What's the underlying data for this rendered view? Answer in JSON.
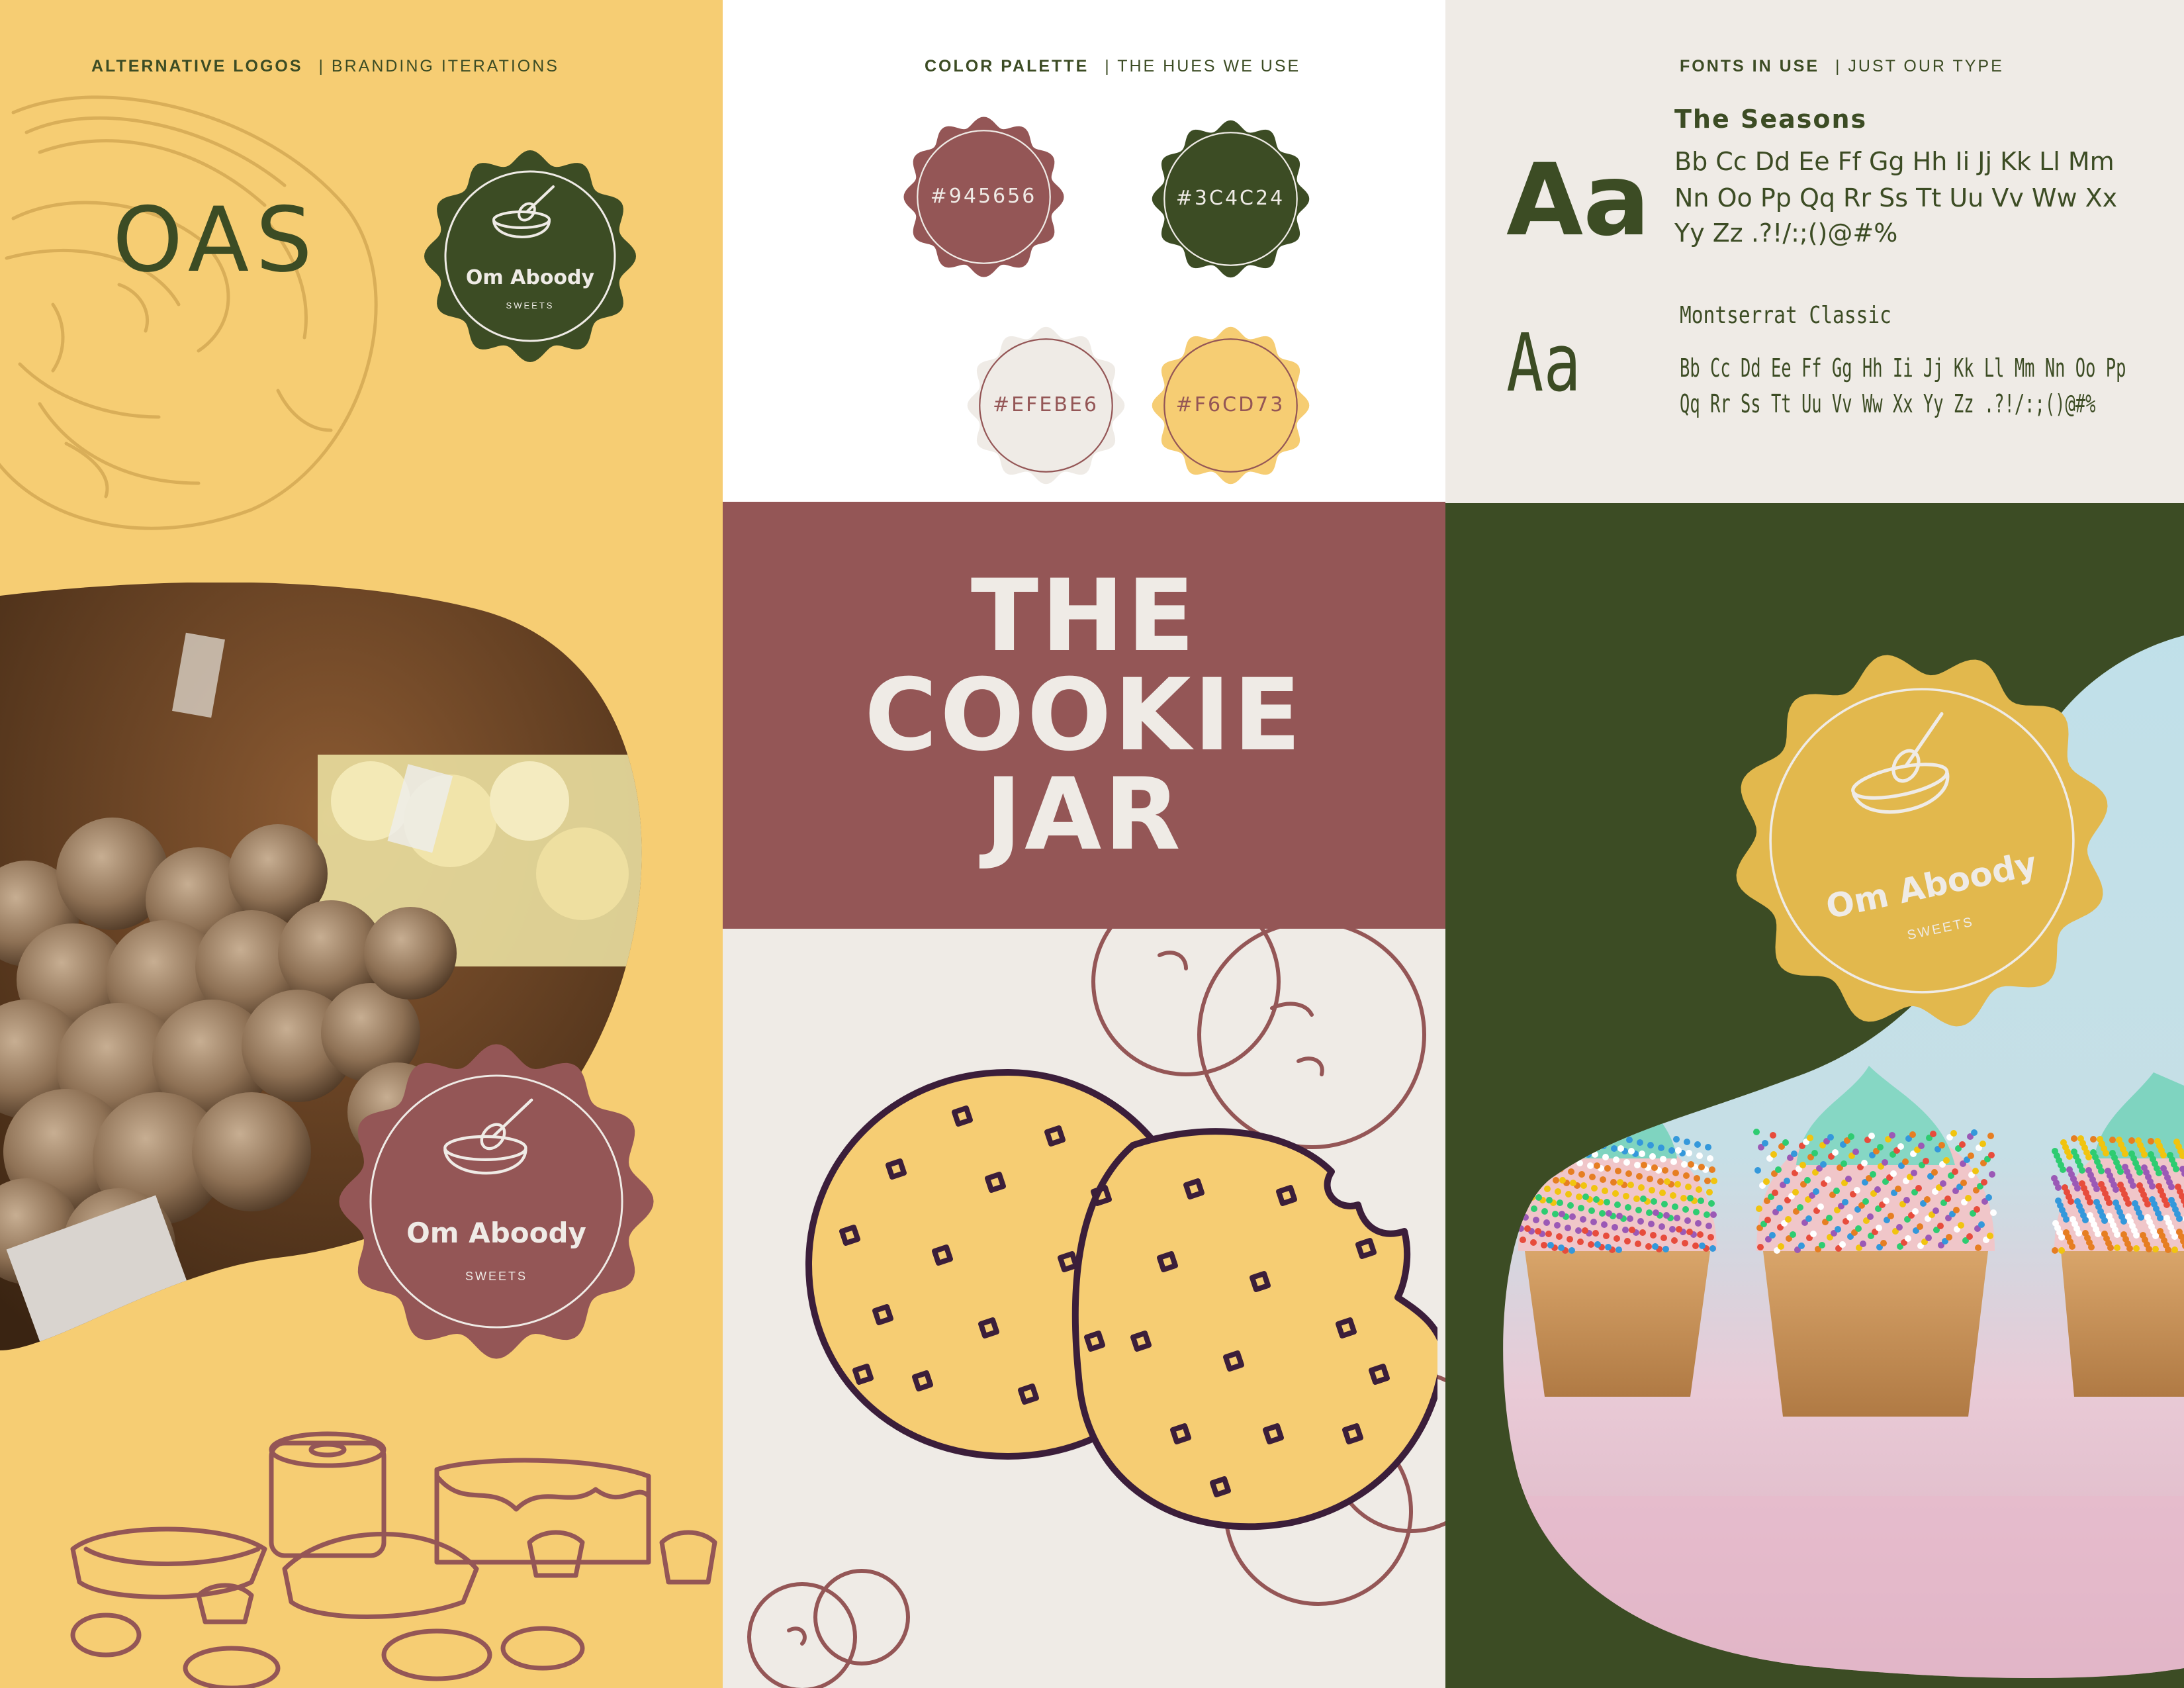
{
  "left_panel": {
    "heading_bold": "ALTERNATIVE LOGOS",
    "heading_sub": "| BRANDING ITERATIONS",
    "wordmark": "OAS",
    "badge_top": {
      "name": "Om Aboody",
      "sub": "SWEETS"
    },
    "badge_bottom": {
      "name": "Om Aboody",
      "sub": "SWEETS"
    }
  },
  "mid_panel": {
    "heading_bold": "COLOR PALETTE",
    "heading_sub": "|  THE HUES WE USE",
    "swatches": [
      {
        "label": "#945656",
        "color": "#945656"
      },
      {
        "label": "#3C4C24",
        "color": "#3C4C24"
      },
      {
        "label": "#EFEBE6",
        "color": "#EFEBE6"
      },
      {
        "label": "#F6CD73",
        "color": "#F6CD73"
      }
    ],
    "title_lines": [
      "THE",
      "COOKIE",
      "JAR"
    ]
  },
  "right_panel": {
    "heading_bold": "FONTS IN USE",
    "heading_sub": "| JUST OUR TYPE",
    "font1": {
      "name": "The Seasons",
      "sample": "Aa",
      "alphabet_lines": [
        "Bb Cc Dd Ee Ff Gg Hh Ii Jj Kk Ll Mm",
        "Nn Oo Pp Qq Rr Ss Tt Uu Vv Ww Xx",
        "Yy Zz .?!/:;()@#%"
      ]
    },
    "font2": {
      "name": "Montserrat Classic",
      "sample": "Aa",
      "alphabet_lines": [
        "Bb Cc Dd Ee Ff Gg Hh Ii Jj Kk Ll Mm Nn Oo Pp",
        "Qq Rr Ss Tt Uu Vv Ww Xx Yy Zz .?!/:;()@#%"
      ]
    },
    "badge": {
      "name": "Om Aboody",
      "sub": "SWEETS"
    }
  },
  "colors": {
    "maroon": "#945656",
    "green": "#3C4C24",
    "cream": "#EFEBE6",
    "yellow": "#F6CD73",
    "badge_gold": "#E2B84D",
    "sky": "#BFE1EA",
    "cookie_outline": "#3B1E3A"
  },
  "icons": [
    "whisk-bowl-icon",
    "croissant-sketch",
    "pastries-sketch",
    "cookie-illustration",
    "cookie-sketch"
  ]
}
